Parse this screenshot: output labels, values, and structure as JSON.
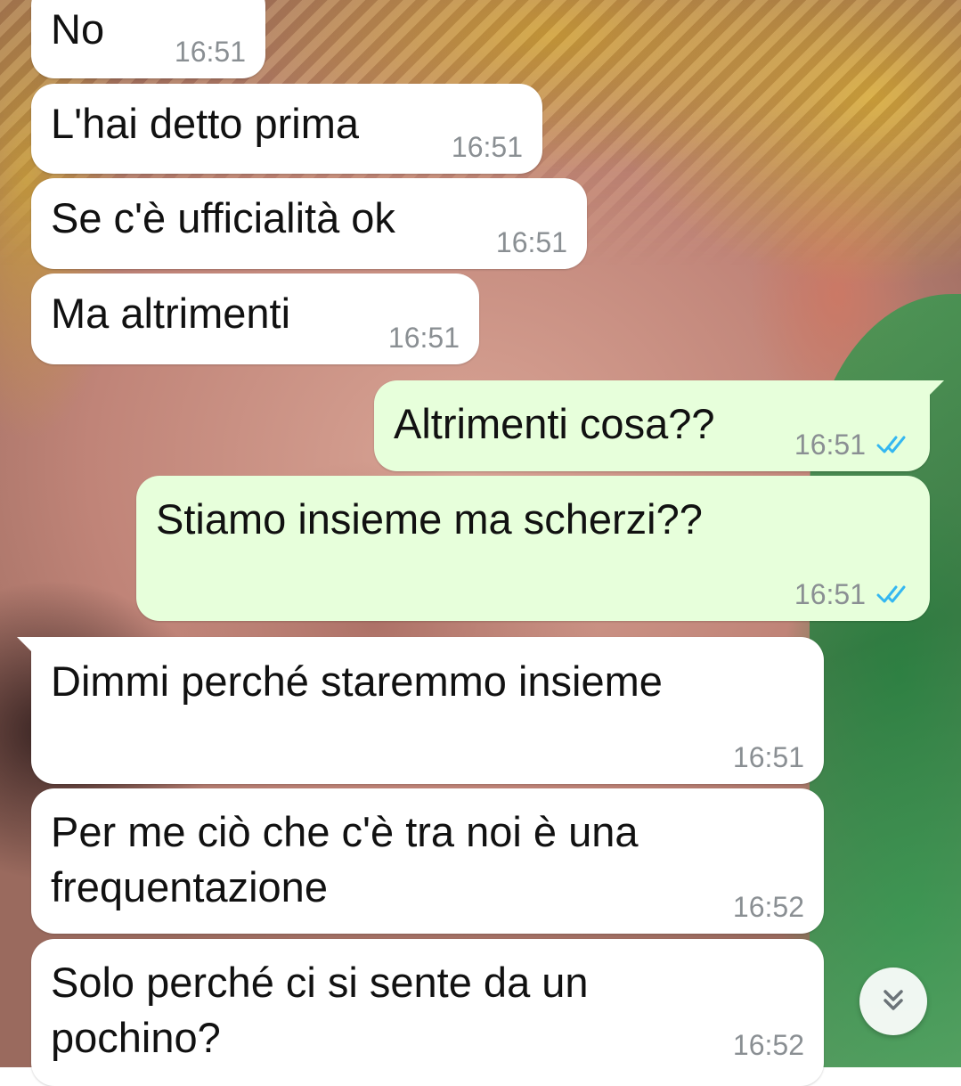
{
  "messages": [
    {
      "direction": "in",
      "text": "No",
      "time": "16:51"
    },
    {
      "direction": "in",
      "text": "L'hai detto prima",
      "time": "16:51"
    },
    {
      "direction": "in",
      "text": "Se c'è ufficialità ok",
      "time": "16:51"
    },
    {
      "direction": "in",
      "text": "Ma altrimenti",
      "time": "16:51"
    },
    {
      "direction": "out",
      "text": "Altrimenti cosa??",
      "time": "16:51",
      "status": "read"
    },
    {
      "direction": "out",
      "text": "Stiamo insieme ma scherzi??",
      "time": "16:51",
      "status": "read"
    },
    {
      "direction": "in",
      "text": "Dimmi perché staremmo insieme",
      "time": "16:51"
    },
    {
      "direction": "in",
      "text": "Per me ciò che c'è tra noi è una\nfrequentazione",
      "time": "16:52"
    },
    {
      "direction": "in",
      "text": "Solo perché ci si sente da un\npochino?",
      "time": "16:52"
    }
  ],
  "colors": {
    "incoming_bubble": "#ffffff",
    "outgoing_bubble": "#e7ffdb",
    "timestamp": "#8a8f93",
    "read_ticks": "#34b7f1"
  },
  "icons": {
    "read_receipt": "double-check-icon",
    "scroll_down": "double-chevron-down-icon"
  }
}
